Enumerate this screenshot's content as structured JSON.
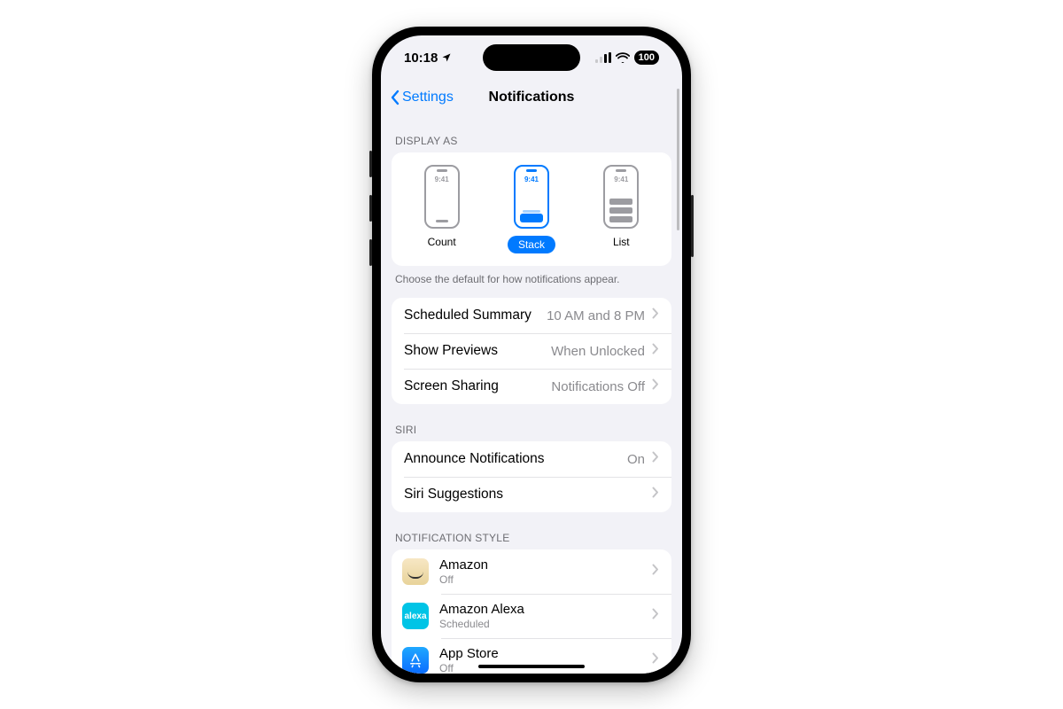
{
  "status": {
    "time": "10:18",
    "battery": "100"
  },
  "nav": {
    "back_label": "Settings",
    "title": "Notifications"
  },
  "display_as": {
    "header": "DISPLAY AS",
    "options": [
      {
        "label": "Count",
        "selected": false,
        "preview_time": "9:41"
      },
      {
        "label": "Stack",
        "selected": true,
        "preview_time": "9:41"
      },
      {
        "label": "List",
        "selected": false,
        "preview_time": "9:41"
      }
    ],
    "footer": "Choose the default for how notifications appear."
  },
  "general": {
    "rows": [
      {
        "label": "Scheduled Summary",
        "value": "10 AM and 8 PM"
      },
      {
        "label": "Show Previews",
        "value": "When Unlocked"
      },
      {
        "label": "Screen Sharing",
        "value": "Notifications Off"
      }
    ]
  },
  "siri": {
    "header": "SIRI",
    "rows": [
      {
        "label": "Announce Notifications",
        "value": "On"
      },
      {
        "label": "Siri Suggestions",
        "value": ""
      }
    ]
  },
  "style": {
    "header": "NOTIFICATION STYLE",
    "apps": [
      {
        "name": "Amazon",
        "sub": "Off",
        "icon": "amazon"
      },
      {
        "name": "Amazon Alexa",
        "sub": "Scheduled",
        "icon": "alexa"
      },
      {
        "name": "App Store",
        "sub": "Off",
        "icon": "appstore"
      }
    ]
  }
}
